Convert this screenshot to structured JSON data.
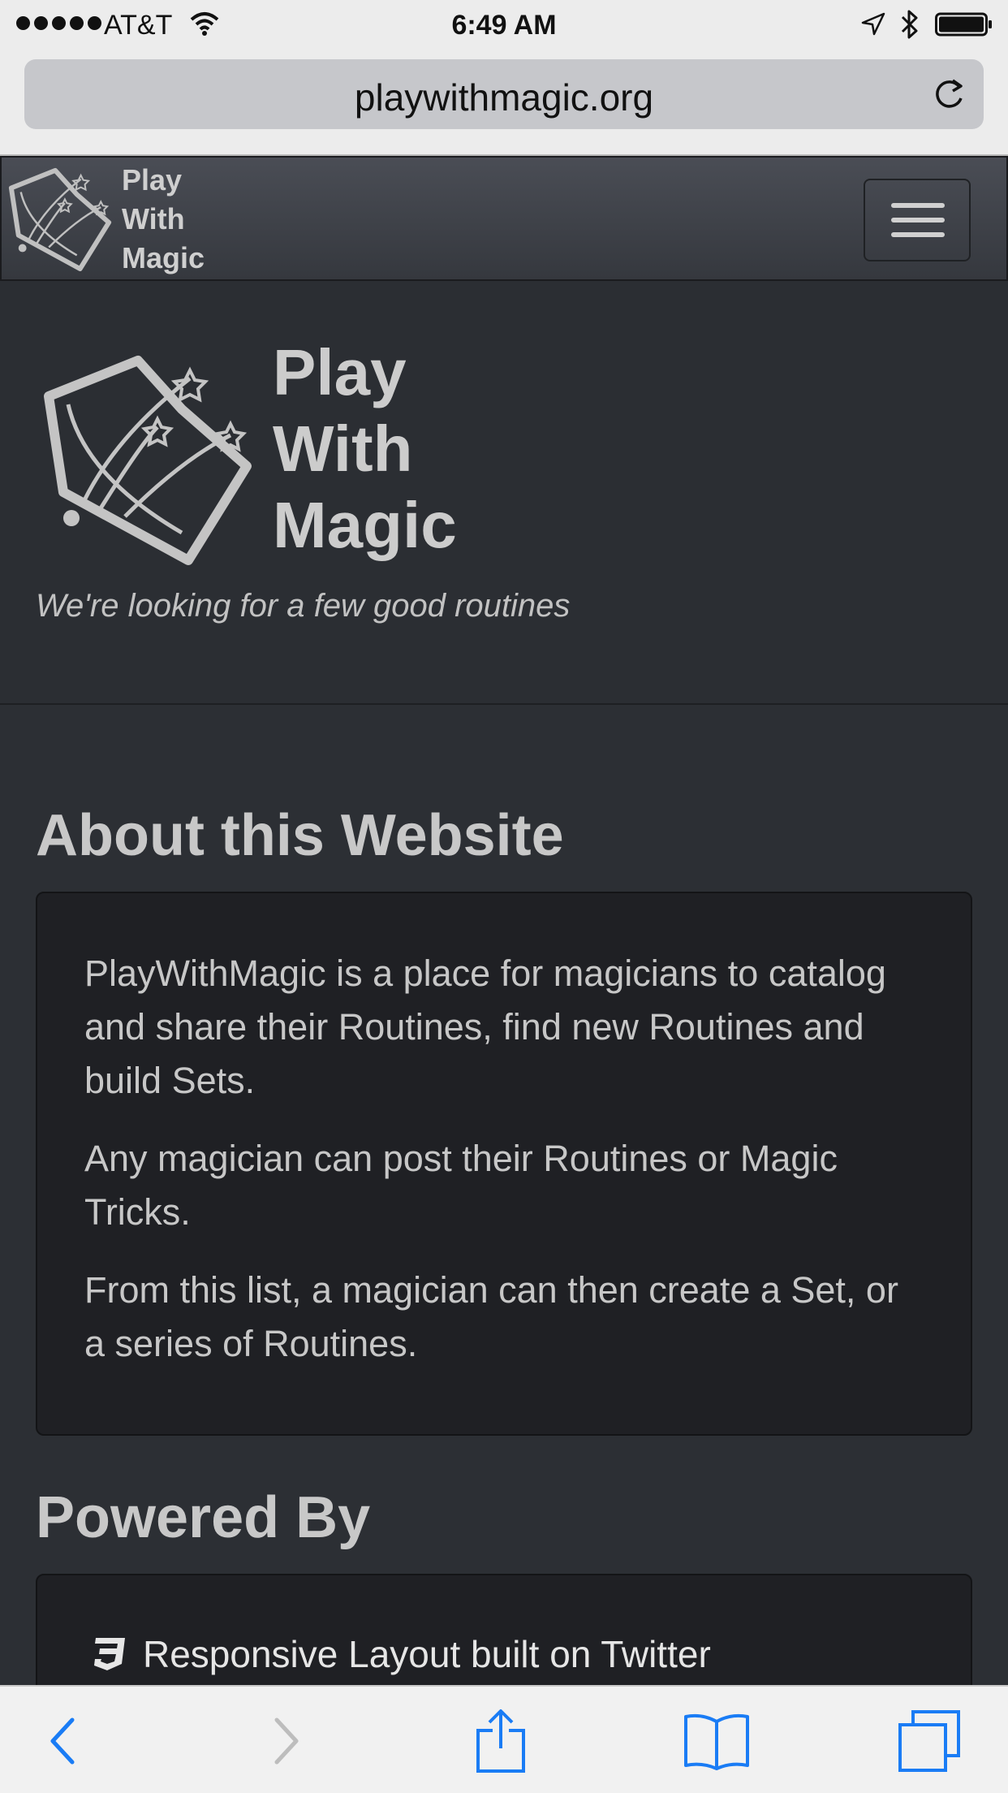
{
  "status_bar": {
    "carrier": "AT&T",
    "time": "6:49 AM",
    "signal_icon": "signal-dots-icon",
    "wifi_icon": "wifi-icon",
    "location_icon": "location-arrow-icon",
    "bluetooth_icon": "bluetooth-icon",
    "battery_icon": "battery-icon",
    "battery_level": 1.0
  },
  "browser": {
    "url": "playwithmagic.org",
    "reload_icon": "reload-icon"
  },
  "navbar": {
    "brand_lines": [
      "Play",
      "With",
      "Magic"
    ],
    "logo_icon": "magic-book-logo-icon",
    "toggle_icon": "hamburger-menu-icon"
  },
  "hero": {
    "brand_lines": [
      "Play",
      "With",
      "Magic"
    ],
    "tagline": "We're looking for a few good routines"
  },
  "about": {
    "title": "About this Website",
    "paragraphs": [
      "PlayWithMagic is a place for magicians to catalog and share their Routines, find new Routines and build Sets.",
      "Any magician can post their Routines or Magic Tricks.",
      "From this list, a magician can then create a Set, or a series of Routines."
    ]
  },
  "powered_by": {
    "title": "Powered By",
    "items": [
      {
        "icon": "css3-icon",
        "label": "Responsive Layout built on Twitter"
      }
    ]
  },
  "toolbar": {
    "back_icon": "back-chevron-icon",
    "forward_icon": "forward-chevron-icon",
    "share_icon": "share-icon",
    "bookmarks_icon": "bookmarks-book-icon",
    "tabs_icon": "tabs-icon"
  },
  "colors": {
    "page_background": "#2c2f34",
    "well_background": "#1f2024",
    "text_light": "#c8c8c8",
    "ios_blue": "#1a7cf5"
  }
}
